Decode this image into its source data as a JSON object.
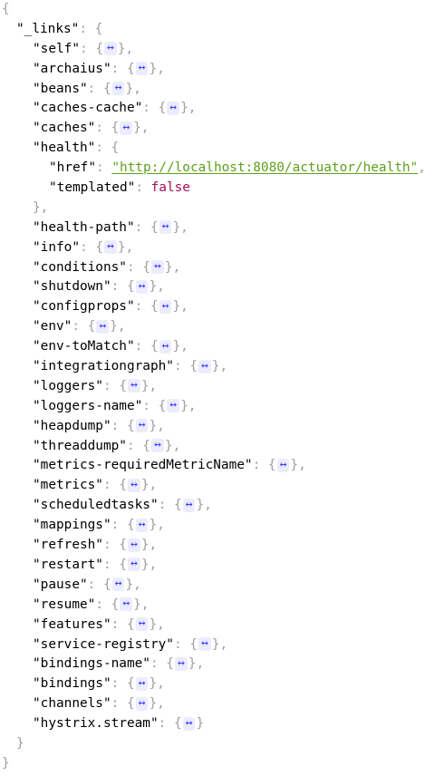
{
  "json": {
    "root_open": "{",
    "root_close": "}",
    "links_key": "\"_links\"",
    "links_open": "{",
    "links_close": "}",
    "collapsed_marker": "↔",
    "entries_before": [
      "\"self\"",
      "\"archaius\"",
      "\"beans\"",
      "\"caches-cache\"",
      "\"caches\""
    ],
    "health": {
      "key": "\"health\"",
      "open": "{",
      "href_key": "\"href\"",
      "href_value": "\"http://localhost:8080/actuator/health\"",
      "templated_key": "\"templated\"",
      "templated_value": "false",
      "close": "},"
    },
    "entries_after": [
      "\"health-path\"",
      "\"info\"",
      "\"conditions\"",
      "\"shutdown\"",
      "\"configprops\"",
      "\"env\"",
      "\"env-toMatch\"",
      "\"integrationgraph\"",
      "\"loggers\"",
      "\"loggers-name\"",
      "\"heapdump\"",
      "\"threaddump\"",
      "\"metrics-requiredMetricName\"",
      "\"metrics\"",
      "\"scheduledtasks\"",
      "\"mappings\"",
      "\"refresh\"",
      "\"restart\"",
      "\"pause\"",
      "\"resume\"",
      "\"features\"",
      "\"service-registry\"",
      "\"bindings-name\"",
      "\"bindings\"",
      "\"channels\"",
      "\"hystrix.stream\""
    ]
  }
}
